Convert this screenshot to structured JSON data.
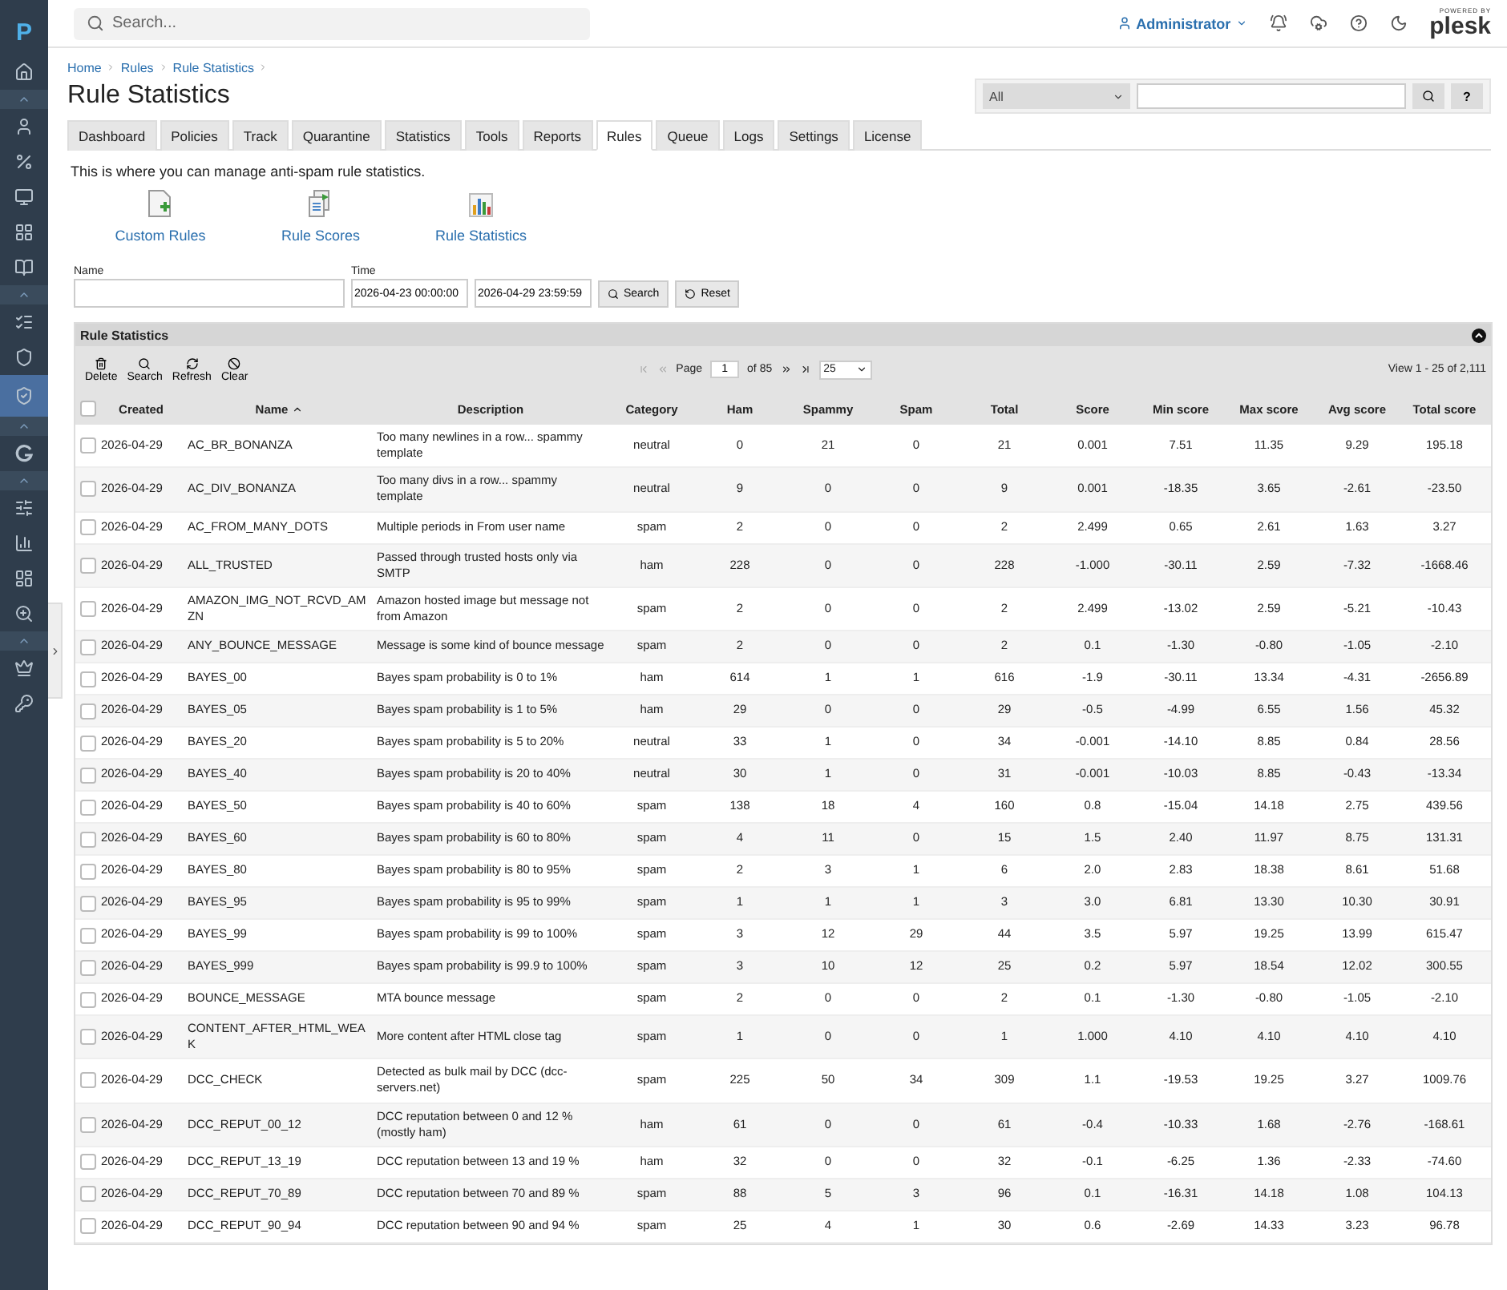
{
  "sidebar": {
    "logo": "P",
    "items": [
      {
        "selected": false
      },
      {
        "selected": false
      },
      {
        "selected": false
      },
      {
        "selected": false
      },
      {
        "selected": false
      },
      {
        "selected": false
      },
      {
        "selected": false
      },
      {
        "selected": false
      },
      {
        "selected": true
      },
      {
        "selected": false
      },
      {
        "selected": false
      },
      {
        "selected": false
      },
      {
        "selected": false
      },
      {
        "selected": false
      },
      {
        "selected": false
      },
      {
        "selected": false
      }
    ]
  },
  "topbar": {
    "search_placeholder": "Search...",
    "user": "Administrator",
    "powered_by": "POWERED BY",
    "brand": "plesk"
  },
  "breadcrumbs": [
    "Home",
    "Rules",
    "Rule Statistics"
  ],
  "title": "Rule Statistics",
  "quick_search": {
    "filter": "All",
    "help": "?"
  },
  "tabs": [
    {
      "label": "Dashboard",
      "selected": false
    },
    {
      "label": "Policies",
      "selected": false
    },
    {
      "label": "Track",
      "selected": false
    },
    {
      "label": "Quarantine",
      "selected": false
    },
    {
      "label": "Statistics",
      "selected": false
    },
    {
      "label": "Tools",
      "selected": false
    },
    {
      "label": "Reports",
      "selected": false
    },
    {
      "label": "Rules",
      "selected": true
    },
    {
      "label": "Queue",
      "selected": false
    },
    {
      "label": "Logs",
      "selected": false
    },
    {
      "label": "Settings",
      "selected": false
    },
    {
      "label": "License",
      "selected": false
    }
  ],
  "intro": "This is where you can manage anti-spam rule statistics.",
  "shortcuts": [
    {
      "kind": "custom",
      "label": "Custom Rules"
    },
    {
      "kind": "scores",
      "label": "Rule Scores"
    },
    {
      "kind": "stats",
      "label": "Rule Statistics"
    }
  ],
  "filter": {
    "name_label": "Name",
    "time_label": "Time",
    "time_from": "2026-04-23 00:00:00",
    "time_to": "2026-04-29 23:59:59",
    "search": "Search",
    "reset": "Reset"
  },
  "panel": {
    "title": "Rule Statistics",
    "tools": [
      {
        "kind": "delete",
        "label": "Delete"
      },
      {
        "kind": "search",
        "label": "Search"
      },
      {
        "kind": "refresh",
        "label": "Refresh"
      },
      {
        "kind": "clear",
        "label": "Clear"
      }
    ],
    "pager": {
      "page_label": "Page",
      "page": "1",
      "of": "of 85",
      "per_page": "25",
      "view": "View 1 - 25 of 2,111"
    }
  },
  "table": {
    "all_checked": false,
    "columns": [
      {
        "label": "Created"
      },
      {
        "label": "Name",
        "sort_ascending": true
      },
      {
        "label": "Description"
      },
      {
        "label": "Category"
      },
      {
        "label": "Ham"
      },
      {
        "label": "Spammy"
      },
      {
        "label": "Spam"
      },
      {
        "label": "Total"
      },
      {
        "label": "Score"
      },
      {
        "label": "Min score"
      },
      {
        "label": "Max score"
      },
      {
        "label": "Avg score"
      },
      {
        "label": "Total score"
      }
    ],
    "rows": [
      {
        "checked": false,
        "cells": [
          "2026-04-29",
          "AC_BR_BONANZA",
          "Too many newlines in a row... spammy template",
          "neutral",
          "0",
          "21",
          "0",
          "21",
          "0.001",
          "7.51",
          "11.35",
          "9.29",
          "195.18"
        ]
      },
      {
        "checked": false,
        "cells": [
          "2026-04-29",
          "AC_DIV_BONANZA",
          "Too many divs in a row... spammy template",
          "neutral",
          "9",
          "0",
          "0",
          "9",
          "0.001",
          "-18.35",
          "3.65",
          "-2.61",
          "-23.50"
        ]
      },
      {
        "checked": false,
        "cells": [
          "2026-04-29",
          "AC_FROM_MANY_DOTS",
          "Multiple periods in From user name",
          "spam",
          "2",
          "0",
          "0",
          "2",
          "2.499",
          "0.65",
          "2.61",
          "1.63",
          "3.27"
        ]
      },
      {
        "checked": false,
        "cells": [
          "2026-04-29",
          "ALL_TRUSTED",
          "Passed through trusted hosts only via SMTP",
          "ham",
          "228",
          "0",
          "0",
          "228",
          "-1.000",
          "-30.11",
          "2.59",
          "-7.32",
          "-1668.46"
        ]
      },
      {
        "checked": false,
        "cells": [
          "2026-04-29",
          "AMAZON_IMG_NOT_RCVD_AMZN",
          "Amazon hosted image but message not from Amazon",
          "spam",
          "2",
          "0",
          "0",
          "2",
          "2.499",
          "-13.02",
          "2.59",
          "-5.21",
          "-10.43"
        ]
      },
      {
        "checked": false,
        "cells": [
          "2026-04-29",
          "ANY_BOUNCE_MESSAGE",
          "Message is some kind of bounce message",
          "spam",
          "2",
          "0",
          "0",
          "2",
          "0.1",
          "-1.30",
          "-0.80",
          "-1.05",
          "-2.10"
        ]
      },
      {
        "checked": false,
        "cells": [
          "2026-04-29",
          "BAYES_00",
          "Bayes spam probability is 0 to 1%",
          "ham",
          "614",
          "1",
          "1",
          "616",
          "-1.9",
          "-30.11",
          "13.34",
          "-4.31",
          "-2656.89"
        ]
      },
      {
        "checked": false,
        "cells": [
          "2026-04-29",
          "BAYES_05",
          "Bayes spam probability is 1 to 5%",
          "ham",
          "29",
          "0",
          "0",
          "29",
          "-0.5",
          "-4.99",
          "6.55",
          "1.56",
          "45.32"
        ]
      },
      {
        "checked": false,
        "cells": [
          "2026-04-29",
          "BAYES_20",
          "Bayes spam probability is 5 to 20%",
          "neutral",
          "33",
          "1",
          "0",
          "34",
          "-0.001",
          "-14.10",
          "8.85",
          "0.84",
          "28.56"
        ]
      },
      {
        "checked": false,
        "cells": [
          "2026-04-29",
          "BAYES_40",
          "Bayes spam probability is 20 to 40%",
          "neutral",
          "30",
          "1",
          "0",
          "31",
          "-0.001",
          "-10.03",
          "8.85",
          "-0.43",
          "-13.34"
        ]
      },
      {
        "checked": false,
        "cells": [
          "2026-04-29",
          "BAYES_50",
          "Bayes spam probability is 40 to 60%",
          "spam",
          "138",
          "18",
          "4",
          "160",
          "0.8",
          "-15.04",
          "14.18",
          "2.75",
          "439.56"
        ]
      },
      {
        "checked": false,
        "cells": [
          "2026-04-29",
          "BAYES_60",
          "Bayes spam probability is 60 to 80%",
          "spam",
          "4",
          "11",
          "0",
          "15",
          "1.5",
          "2.40",
          "11.97",
          "8.75",
          "131.31"
        ]
      },
      {
        "checked": false,
        "cells": [
          "2026-04-29",
          "BAYES_80",
          "Bayes spam probability is 80 to 95%",
          "spam",
          "2",
          "3",
          "1",
          "6",
          "2.0",
          "2.83",
          "18.38",
          "8.61",
          "51.68"
        ]
      },
      {
        "checked": false,
        "cells": [
          "2026-04-29",
          "BAYES_95",
          "Bayes spam probability is 95 to 99%",
          "spam",
          "1",
          "1",
          "1",
          "3",
          "3.0",
          "6.81",
          "13.30",
          "10.30",
          "30.91"
        ]
      },
      {
        "checked": false,
        "cells": [
          "2026-04-29",
          "BAYES_99",
          "Bayes spam probability is 99 to 100%",
          "spam",
          "3",
          "12",
          "29",
          "44",
          "3.5",
          "5.97",
          "19.25",
          "13.99",
          "615.47"
        ]
      },
      {
        "checked": false,
        "cells": [
          "2026-04-29",
          "BAYES_999",
          "Bayes spam probability is 99.9 to 100%",
          "spam",
          "3",
          "10",
          "12",
          "25",
          "0.2",
          "5.97",
          "18.54",
          "12.02",
          "300.55"
        ]
      },
      {
        "checked": false,
        "cells": [
          "2026-04-29",
          "BOUNCE_MESSAGE",
          "MTA bounce message",
          "spam",
          "2",
          "0",
          "0",
          "2",
          "0.1",
          "-1.30",
          "-0.80",
          "-1.05",
          "-2.10"
        ]
      },
      {
        "checked": false,
        "cells": [
          "2026-04-29",
          "CONTENT_AFTER_HTML_WEAK",
          "More content after HTML close tag",
          "spam",
          "1",
          "0",
          "0",
          "1",
          "1.000",
          "4.10",
          "4.10",
          "4.10",
          "4.10"
        ]
      },
      {
        "checked": false,
        "cells": [
          "2026-04-29",
          "DCC_CHECK",
          "Detected as bulk mail by DCC (dcc-servers.net)",
          "spam",
          "225",
          "50",
          "34",
          "309",
          "1.1",
          "-19.53",
          "19.25",
          "3.27",
          "1009.76"
        ]
      },
      {
        "checked": false,
        "cells": [
          "2026-04-29",
          "DCC_REPUT_00_12",
          "DCC reputation between 0 and 12 % (mostly ham)",
          "ham",
          "61",
          "0",
          "0",
          "61",
          "-0.4",
          "-10.33",
          "1.68",
          "-2.76",
          "-168.61"
        ]
      },
      {
        "checked": false,
        "cells": [
          "2026-04-29",
          "DCC_REPUT_13_19",
          "DCC reputation between 13 and 19 %",
          "ham",
          "32",
          "0",
          "0",
          "32",
          "-0.1",
          "-6.25",
          "1.36",
          "-2.33",
          "-74.60"
        ]
      },
      {
        "checked": false,
        "cells": [
          "2026-04-29",
          "DCC_REPUT_70_89",
          "DCC reputation between 70 and 89 %",
          "spam",
          "88",
          "5",
          "3",
          "96",
          "0.1",
          "-16.31",
          "14.18",
          "1.08",
          "104.13"
        ]
      },
      {
        "checked": false,
        "cells": [
          "2026-04-29",
          "DCC_REPUT_90_94",
          "DCC reputation between 90 and 94 %",
          "spam",
          "25",
          "4",
          "1",
          "30",
          "0.6",
          "-2.69",
          "14.33",
          "3.23",
          "96.78"
        ]
      }
    ]
  }
}
